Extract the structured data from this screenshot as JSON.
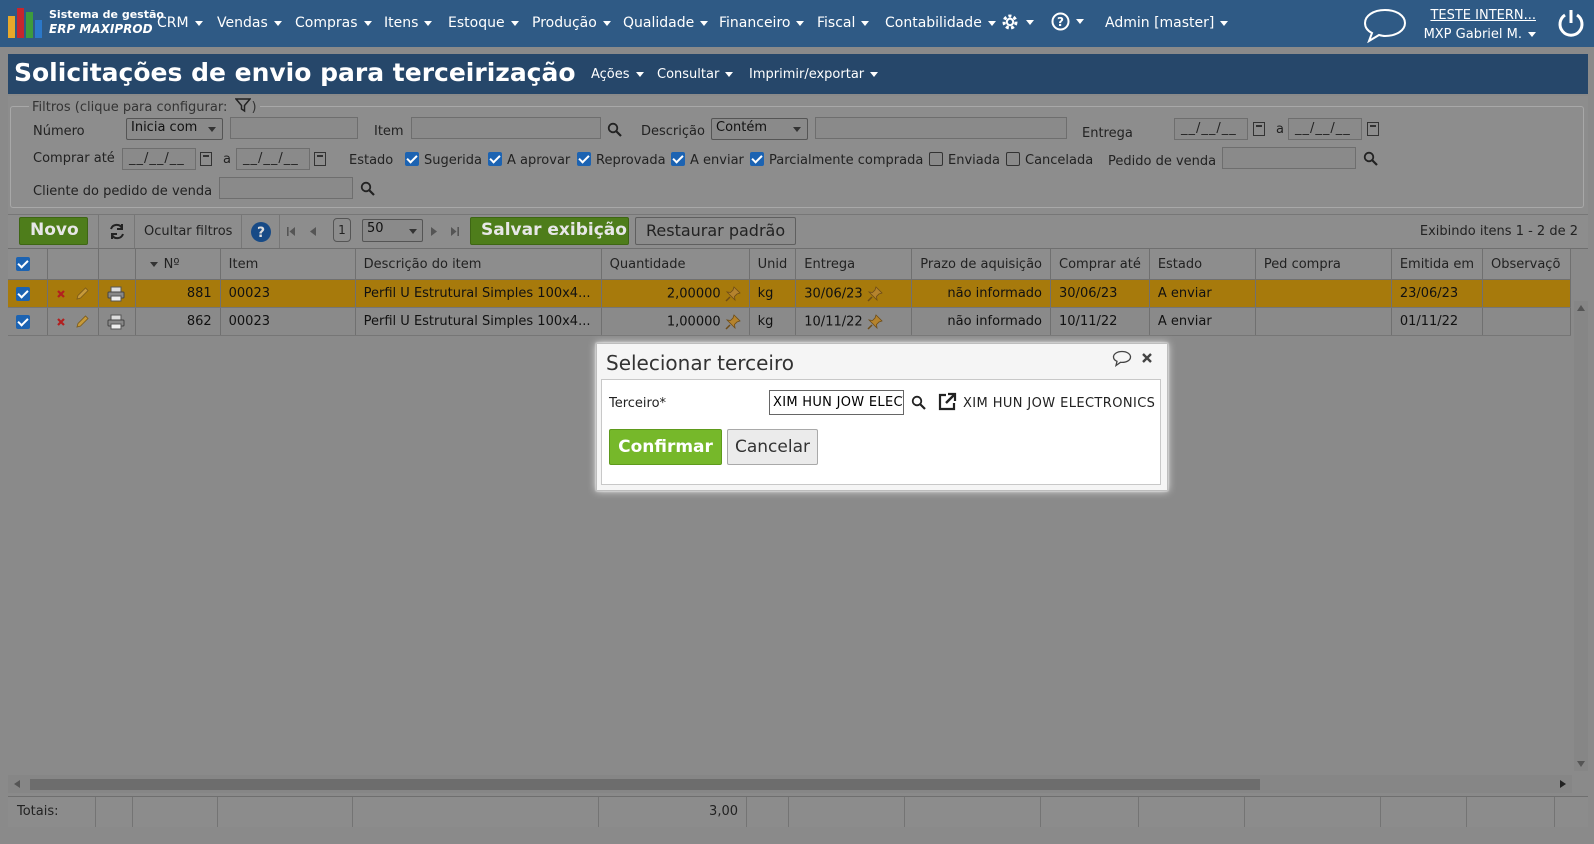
{
  "topbar": {
    "logo_line1": "Sistema de gestão",
    "logo_line2": "ERP MAXIPROD",
    "menus": [
      "CRM",
      "Vendas",
      "Compras",
      "Itens",
      "Estoque",
      "Produção",
      "Qualidade",
      "Financeiro",
      "Fiscal",
      "Contabilidade"
    ],
    "admin": "Admin [master]",
    "company": "TESTE INTERN...",
    "user": "MXP Gabriel M."
  },
  "page": {
    "title": "Solicitações de envio para terceirização",
    "menus": [
      "Ações",
      "Consultar",
      "Imprimir/exportar"
    ]
  },
  "filters": {
    "legend": "Filtros (clique para configurar:",
    "legend_close": ")",
    "numero_label": "Número",
    "numero_mode": "Inicia com",
    "item_label": "Item",
    "descricao_label": "Descrição",
    "descricao_mode": "Contém",
    "entrega_label": "Entrega",
    "date_placeholder": "__/__/__",
    "range_sep": "a",
    "comprar_ate_label": "Comprar até",
    "estado_label": "Estado",
    "estados": [
      {
        "label": "Sugerida",
        "checked": true
      },
      {
        "label": "A aprovar",
        "checked": true
      },
      {
        "label": "Reprovada",
        "checked": true
      },
      {
        "label": "A enviar",
        "checked": true
      },
      {
        "label": "Parcialmente comprada",
        "checked": true
      },
      {
        "label": "Enviada",
        "checked": false
      },
      {
        "label": "Cancelada",
        "checked": false
      }
    ],
    "pedido_venda_label": "Pedido de venda",
    "cliente_pedido_label": "Cliente do pedido de venda"
  },
  "toolbar": {
    "novo": "Novo",
    "ocultar_filtros": "Ocultar filtros",
    "page": "1",
    "page_size": "50",
    "salvar_exibicao": "Salvar exibição",
    "restaurar_padrao": "Restaurar padrão",
    "exibindo": "Exibindo itens 1 - 2 de 2"
  },
  "grid": {
    "columns": [
      "Nº",
      "Item",
      "Descrição do item",
      "Quantidade",
      "Unid",
      "Entrega",
      "Prazo de aquisição",
      "Comprar até",
      "Estado",
      "Ped compra",
      "Emitida em",
      "Observaçõ"
    ],
    "rows": [
      {
        "numero": "881",
        "item": "00023",
        "descricao": "Perfil U Estrutural Simples 100x4...",
        "quantidade": "2,00000",
        "unid": "kg",
        "entrega": "30/06/23",
        "prazo": "não informado",
        "comprar_ate": "30/06/23",
        "estado": "A enviar",
        "ped_compra": "",
        "emitida_em": "23/06/23",
        "observacoes": ""
      },
      {
        "numero": "862",
        "item": "00023",
        "descricao": "Perfil U Estrutural Simples 100x4...",
        "quantidade": "1,00000",
        "unid": "kg",
        "entrega": "10/11/22",
        "prazo": "não informado",
        "comprar_ate": "10/11/22",
        "estado": "A enviar",
        "ped_compra": "",
        "emitida_em": "01/11/22",
        "observacoes": ""
      }
    ],
    "totals_label": "Totais:",
    "totals_quantidade": "3,00"
  },
  "dialog": {
    "title": "Selecionar terceiro",
    "field_label": "Terceiro*",
    "field_value": "XIM HUN JOW ELECTRONICS",
    "result_text": "XIM HUN JOW ELECTRONICS",
    "confirm": "Confirmar",
    "cancel": "Cancelar"
  },
  "colors": {
    "topbar": "#2f5a85",
    "selected_row": "#a77a0c",
    "green_button": "#76b82a",
    "overlay": "#8a8a8a"
  }
}
